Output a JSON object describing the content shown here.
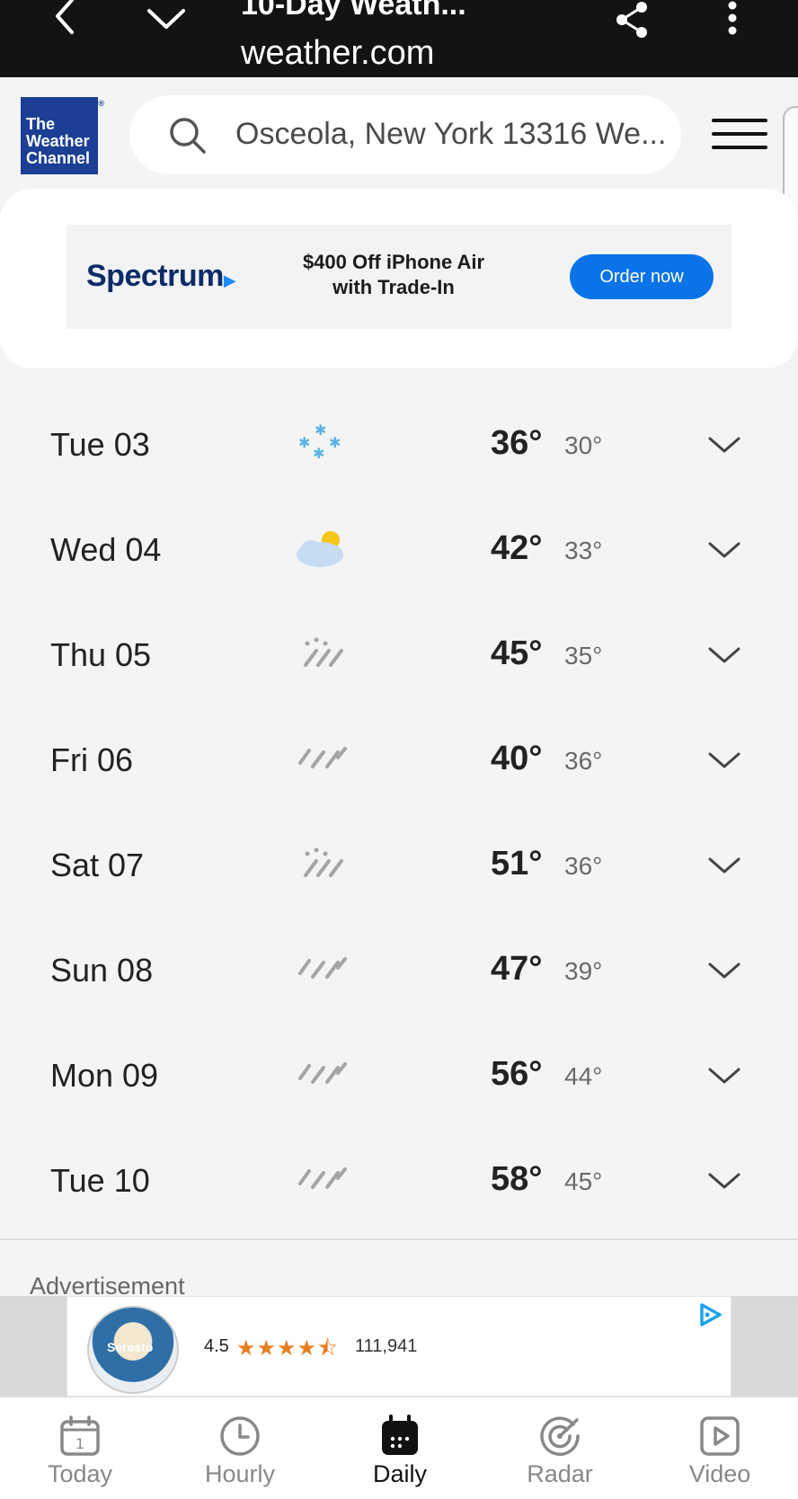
{
  "browser": {
    "title": "10-Day Weath...",
    "url": "weather.com"
  },
  "header": {
    "logo_lines": [
      "The",
      "Weather",
      "Channel"
    ],
    "search_text": "Osceola, New York 13316 We...",
    "icons": {
      "search": "search-icon",
      "menu": "hamburger-menu-icon"
    }
  },
  "top_ad": {
    "brand": "Spectrum",
    "copy_line1": "$400 Off iPhone Air",
    "copy_line2": "with Trade-In",
    "cta": "Order now",
    "cta_color": "#0a73e8"
  },
  "days": [
    {
      "date": "Tue 03",
      "icon": "snow-icon",
      "high": "36°",
      "low": "30°"
    },
    {
      "date": "Wed 04",
      "icon": "partly-cloudy-icon",
      "high": "42°",
      "low": "33°"
    },
    {
      "date": "Thu 05",
      "icon": "rain-snow-icon",
      "high": "45°",
      "low": "35°"
    },
    {
      "date": "Fri 06",
      "icon": "rain-icon",
      "high": "40°",
      "low": "36°"
    },
    {
      "date": "Sat 07",
      "icon": "rain-snow-icon",
      "high": "51°",
      "low": "36°"
    },
    {
      "date": "Sun 08",
      "icon": "rain-icon",
      "high": "47°",
      "low": "39°"
    },
    {
      "date": "Mon 09",
      "icon": "rain-icon",
      "high": "56°",
      "low": "44°"
    },
    {
      "date": "Tue 10",
      "icon": "rain-icon",
      "high": "58°",
      "low": "45°"
    }
  ],
  "advertisement": {
    "label": "Advertisement",
    "product": "Seresto",
    "rating": "4.5",
    "stars": "★★★★⯪",
    "review_count": "111,941"
  },
  "nav": [
    {
      "label": "Today",
      "icon": "calendar-day-icon",
      "active": false
    },
    {
      "label": "Hourly",
      "icon": "clock-icon",
      "active": false
    },
    {
      "label": "Daily",
      "icon": "calendar-grid-icon",
      "active": true
    },
    {
      "label": "Radar",
      "icon": "radar-icon",
      "active": false
    },
    {
      "label": "Video",
      "icon": "video-play-icon",
      "active": false
    }
  ],
  "colors": {
    "brand_blue": "#1c3f95",
    "snow_blue": "#5ab4e5",
    "sun_yellow": "#f5c518",
    "rain_gray": "#a5a5a5"
  }
}
